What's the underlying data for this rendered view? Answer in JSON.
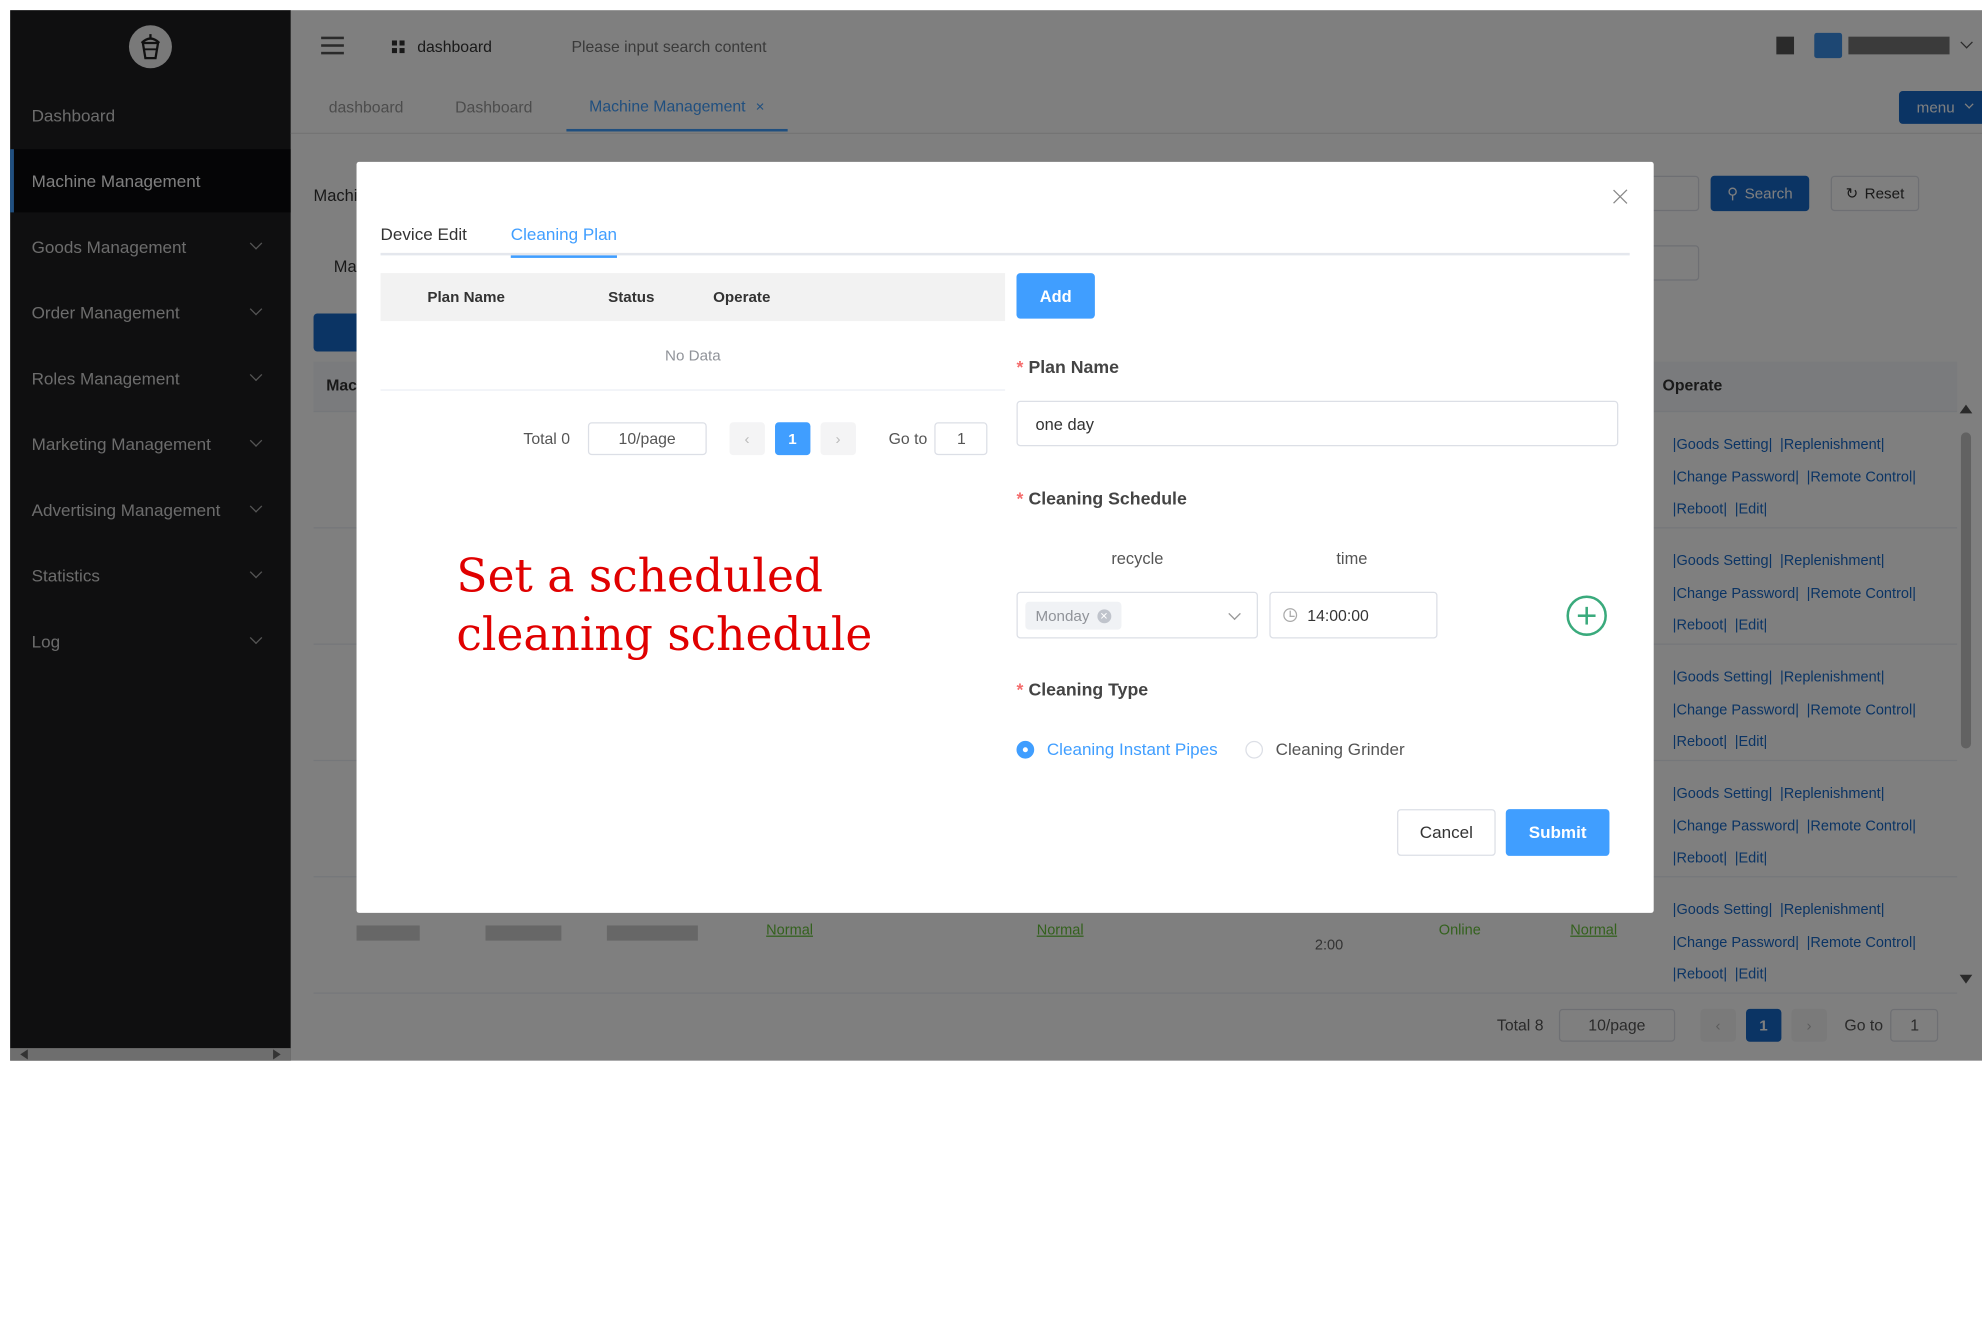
{
  "sidebar": {
    "items": [
      {
        "label": "Dashboard",
        "has_children": false
      },
      {
        "label": "Machine Management",
        "has_children": false,
        "active": true
      },
      {
        "label": "Goods Management",
        "has_children": true
      },
      {
        "label": "Order Management",
        "has_children": true
      },
      {
        "label": "Roles Management",
        "has_children": true
      },
      {
        "label": "Marketing Management",
        "has_children": true
      },
      {
        "label": "Advertising Management",
        "has_children": true
      },
      {
        "label": "Statistics",
        "has_children": true
      },
      {
        "label": "Log",
        "has_children": true
      }
    ]
  },
  "header": {
    "breadcrumb": "dashboard",
    "search_placeholder": "Please input search content"
  },
  "tags": [
    {
      "label": "dashboard"
    },
    {
      "label": "Dashboard"
    },
    {
      "label": "Machine Management",
      "active": true,
      "close": "×"
    }
  ],
  "menu_button": "menu",
  "background_page": {
    "filter_label_1": "Machi",
    "filter_label_2": "Ma",
    "search_button": "Search",
    "reset_button": "Reset",
    "table_first_header": "Mach",
    "operate_header": "Operate",
    "row_ops": {
      "goods_setting": "|Goods Setting|",
      "replenishment": "|Replenishment|",
      "change_password": "|Change Password|",
      "remote_control": "|Remote Control|",
      "reboot": "|Reboot|",
      "edit": "|Edit|"
    },
    "last_row": {
      "status1": "Normal",
      "status2": "Normal",
      "time": "2:00",
      "online": "Online",
      "status3": "Normal"
    },
    "pager": {
      "total": "Total 8",
      "page_size": "10/page",
      "current": "1",
      "goto_label": "Go to",
      "goto_value": "1"
    }
  },
  "dialog": {
    "tabs": [
      {
        "label": "Device Edit"
      },
      {
        "label": "Cleaning Plan",
        "active": true
      }
    ],
    "plan_table": {
      "headers": [
        "Plan Name",
        "Status",
        "Operate"
      ],
      "empty_text": "No Data",
      "pager": {
        "total": "Total 0",
        "page_size": "10/page",
        "current": "1",
        "goto_label": "Go to",
        "goto_value": "1"
      }
    },
    "annotation": "Set a scheduled\ncleaning schedule",
    "add_button": "Add",
    "form": {
      "plan_name_label": "Plan Name",
      "plan_name_value": "one day",
      "schedule_label": "Cleaning Schedule",
      "recycle_label": "recycle",
      "time_label": "time",
      "recycle_value": "Monday",
      "time_value": "14:00:00",
      "type_label": "Cleaning Type",
      "type_options": [
        {
          "label": "Cleaning Instant Pipes",
          "checked": true
        },
        {
          "label": "Cleaning Grinder",
          "checked": false
        }
      ],
      "required_mark": "*"
    },
    "cancel_button": "Cancel",
    "submit_button": "Submit"
  },
  "colors": {
    "primary": "#409eff",
    "sidebar_bg": "#1f1f21",
    "required": "#f56c6c",
    "annotation": "#e00000",
    "add_icon": "#3aaa7c"
  }
}
